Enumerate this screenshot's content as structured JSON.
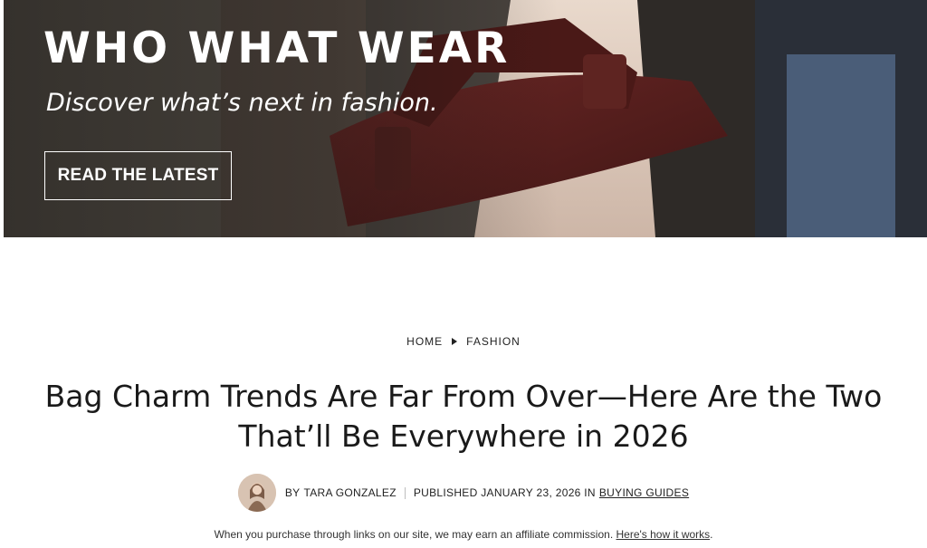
{
  "hero": {
    "brand": "WHO WHAT WEAR",
    "tagline": "Discover what’s next in fashion.",
    "cta_label": "READ THE LATEST"
  },
  "breadcrumb": {
    "home": "HOME",
    "section": "FASHION"
  },
  "article": {
    "title": "Bag Charm Trends Are Far From Over—Here Are the Two That’ll Be Everywhere in 2026",
    "author_prefix": "BY",
    "author": "TARA GONZALEZ",
    "published": "PUBLISHED JANUARY 23, 2026 IN",
    "category": "BUYING GUIDES"
  },
  "disclosure": {
    "text": "When you purchase through links on our site, we may earn an affiliate commission.",
    "link": "Here's how it works",
    "suffix": "."
  },
  "colors": {
    "accent_bag": "#5a1f1c",
    "text": "#1a1a1a"
  }
}
